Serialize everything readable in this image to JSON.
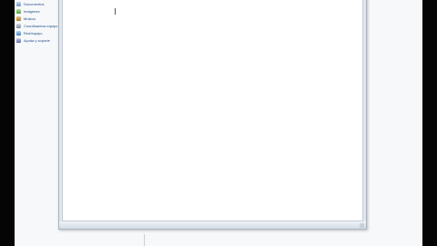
{
  "sidebar": {
    "items": [
      {
        "label": "Documentos",
        "icon": "documents-icon"
      },
      {
        "label": "Imágenes",
        "icon": "pictures-icon"
      },
      {
        "label": "Música",
        "icon": "music-icon"
      },
      {
        "label": "Coordinadora equipo",
        "icon": "computer-icon"
      },
      {
        "label": "Red/equipo",
        "icon": "network-icon"
      },
      {
        "label": "Ayuda y soporte",
        "icon": "help-icon"
      }
    ]
  },
  "editor": {
    "content": ""
  },
  "colors": {
    "window_frame": "#dfe6ee",
    "editor_background": "#ffffff",
    "sidebar_text": "#1f4e8c",
    "letterbox": "#050505"
  }
}
